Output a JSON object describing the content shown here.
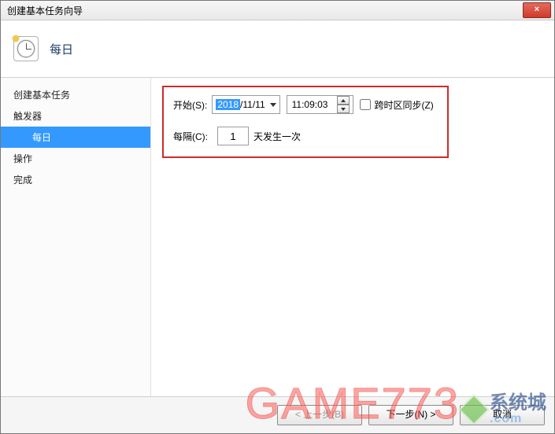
{
  "window": {
    "title": "创建基本任务向导",
    "close_label": "×"
  },
  "header": {
    "title": "每日"
  },
  "sidebar": {
    "items": [
      {
        "label": "创建基本任务",
        "sub": false,
        "selected": false
      },
      {
        "label": "触发器",
        "sub": false,
        "selected": false
      },
      {
        "label": "每日",
        "sub": true,
        "selected": true
      },
      {
        "label": "操作",
        "sub": false,
        "selected": false
      },
      {
        "label": "完成",
        "sub": false,
        "selected": false
      }
    ]
  },
  "form": {
    "start_label": "开始(S):",
    "date_year": "2018",
    "date_rest": "/11/11",
    "time_value": "11:09:03",
    "tz_sync_label": "跨时区同步(Z)",
    "tz_sync_checked": false,
    "recur_label": "每隔(C):",
    "recur_value": "1",
    "recur_suffix": "天发生一次"
  },
  "footer": {
    "back": "< 上一步(B)",
    "next": "下一步(N) >",
    "cancel": "取消"
  },
  "watermark": {
    "game": "GAME773",
    "brand": "系统城",
    "domain": ".com"
  }
}
